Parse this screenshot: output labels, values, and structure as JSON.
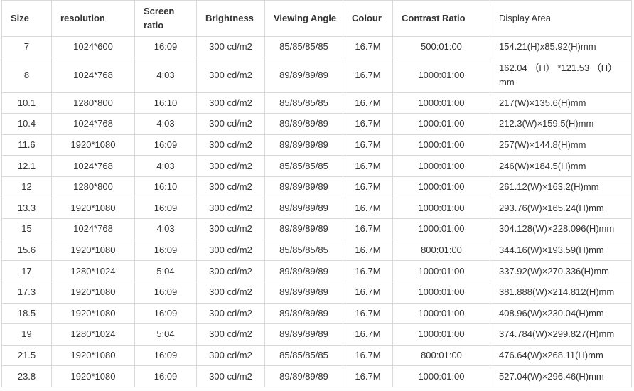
{
  "table": {
    "headers": [
      "Size",
      "resolution",
      "Screen ratio",
      "Brightness",
      "Viewing Angle",
      "Colour",
      "Contrast Ratio",
      "Display Area"
    ],
    "rows": [
      [
        "7",
        "1024*600",
        "16:09",
        "300 cd/m2",
        "85/85/85/85",
        "16.7M",
        "500:01:00",
        "154.21(H)x85.92(H)mm"
      ],
      [
        "8",
        "1024*768",
        "4:03",
        "300 cd/m2",
        "89/89/89/89",
        "16.7M",
        "1000:01:00",
        "162.04 （H） *121.53 （H） mm"
      ],
      [
        "10.1",
        "1280*800",
        "16:10",
        "300 cd/m2",
        "85/85/85/85",
        "16.7M",
        "1000:01:00",
        "217(W)×135.6(H)mm"
      ],
      [
        "10.4",
        "1024*768",
        "4:03",
        "300 cd/m2",
        "89/89/89/89",
        "16.7M",
        "1000:01:00",
        "212.3(W)×159.5(H)mm"
      ],
      [
        "11.6",
        "1920*1080",
        "16:09",
        "300 cd/m2",
        "89/89/89/89",
        "16.7M",
        "1000:01:00",
        "257(W)×144.8(H)mm"
      ],
      [
        "12.1",
        "1024*768",
        "4:03",
        "300 cd/m2",
        "85/85/85/85",
        "16.7M",
        "1000:01:00",
        "246(W)×184.5(H)mm"
      ],
      [
        "12",
        "1280*800",
        "16:10",
        "300 cd/m2",
        "89/89/89/89",
        "16.7M",
        "1000:01:00",
        "261.12(W)×163.2(H)mm"
      ],
      [
        "13.3",
        "1920*1080",
        "16:09",
        "300 cd/m2",
        "89/89/89/89",
        "16.7M",
        "1000:01:00",
        "293.76(W)×165.24(H)mm"
      ],
      [
        "15",
        "1024*768",
        "4:03",
        "300 cd/m2",
        "89/89/89/89",
        "16.7M",
        "1000:01:00",
        "304.128(W)×228.096(H)mm"
      ],
      [
        "15.6",
        "1920*1080",
        "16:09",
        "300 cd/m2",
        "85/85/85/85",
        "16.7M",
        "800:01:00",
        "344.16(W)×193.59(H)mm"
      ],
      [
        "17",
        "1280*1024",
        "5:04",
        "300 cd/m2",
        "89/89/89/89",
        "16.7M",
        "1000:01:00",
        "337.92(W)×270.336(H)mm"
      ],
      [
        "17.3",
        "1920*1080",
        "16:09",
        "300 cd/m2",
        "89/89/89/89",
        "16.7M",
        "1000:01:00",
        "381.888(W)×214.812(H)mm"
      ],
      [
        "18.5",
        "1920*1080",
        "16:09",
        "300 cd/m2",
        "89/89/89/89",
        "16.7M",
        "1000:01:00",
        "408.96(W)×230.04(H)mm"
      ],
      [
        "19",
        "1280*1024",
        "5:04",
        "300 cd/m2",
        "89/89/89/89",
        "16.7M",
        "1000:01:00",
        "374.784(W)×299.827(H)mm"
      ],
      [
        "21.5",
        "1920*1080",
        "16:09",
        "300 cd/m2",
        "85/85/85/85",
        "16.7M",
        "800:01:00",
        "476.64(W)×268.11(H)mm"
      ],
      [
        "23.8",
        "1920*1080",
        "16:09",
        "300 cd/m2",
        "89/89/89/89",
        "16.7M",
        "1000:01:00",
        "527.04(W)×296.46(H)mm"
      ]
    ]
  }
}
